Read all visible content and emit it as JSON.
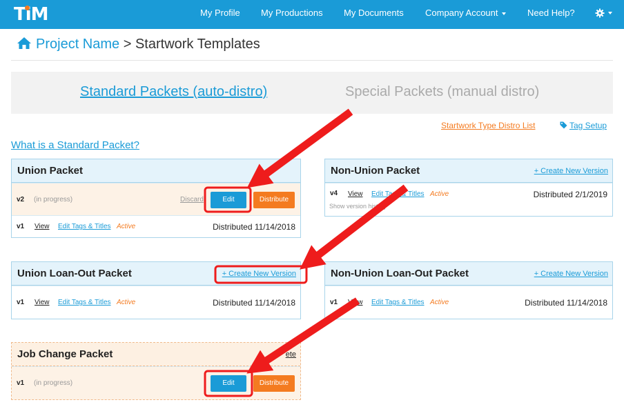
{
  "app": {
    "logo": "TiM"
  },
  "nav": {
    "items": [
      {
        "label": "My Profile"
      },
      {
        "label": "My Productions"
      },
      {
        "label": "My Documents"
      },
      {
        "label": "Company Account"
      },
      {
        "label": "Need Help?"
      }
    ]
  },
  "breadcrumb": {
    "project": "Project Name",
    "separator": ">",
    "page": "Startwork Templates"
  },
  "tabs": {
    "standard": "Standard Packets (auto-distro)",
    "special": "Special Packets (manual distro)"
  },
  "links": {
    "distro_list": "Startwork Type Distro List",
    "tag_setup": "Tag Setup",
    "what_is": "What is a Standard Packet?"
  },
  "common": {
    "view": "View",
    "edit_tags": "Edit Tags & Titles",
    "active": "Active",
    "create_version": "+ Create New Version",
    "in_progress": "(in progress)",
    "discard": "Discard",
    "edit": "Edit",
    "distribute": "Distribute",
    "show_history": "Show version history"
  },
  "packets": {
    "union": {
      "title": "Union Packet",
      "draft_version": "v2",
      "version": "v1",
      "distributed": "Distributed 11/14/2018"
    },
    "non_union": {
      "title": "Non-Union Packet",
      "version": "v4",
      "distributed": "Distributed 2/1/2019"
    },
    "union_loanout": {
      "title": "Union Loan-Out Packet",
      "version": "v1",
      "distributed": "Distributed 11/14/2018"
    },
    "non_union_loanout": {
      "title": "Non-Union Loan-Out Packet",
      "version": "v1",
      "distributed": "Distributed 11/14/2018"
    },
    "job_change": {
      "title": "Job Change Packet",
      "version": "v1",
      "partial_link": "ete"
    }
  },
  "colors": {
    "nav_blue": "#1a9bd7",
    "orange": "#f47b20",
    "annotation_red": "#ee1c1c"
  },
  "icons": {
    "home": "home-icon",
    "gear": "gear-icon",
    "tag": "tag-icon"
  }
}
